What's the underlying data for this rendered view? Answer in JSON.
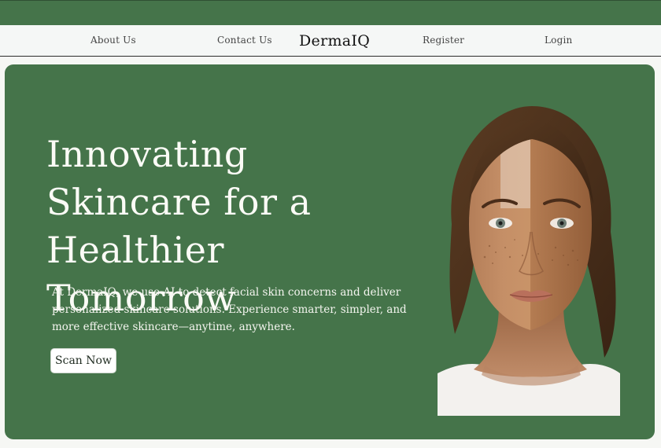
{
  "nav": {
    "about_label": "About Us",
    "contact_label": "Contact Us",
    "brand": "DermaIQ",
    "register_label": "Register",
    "login_label": "Login"
  },
  "hero": {
    "title": "Innovating Skincare for a Healthier Tomorrow",
    "description": "At DermaIQ, we use AI to detect facial skin concerns and deliver personalized skincare solutions. Experience smarter, simpler, and more effective skincare—anytime, anywhere.",
    "cta_label": "Scan Now"
  },
  "colors": {
    "brand_green": "#45744a",
    "nav_background": "#f5f7f6",
    "text_light": "#fbfbf6"
  }
}
